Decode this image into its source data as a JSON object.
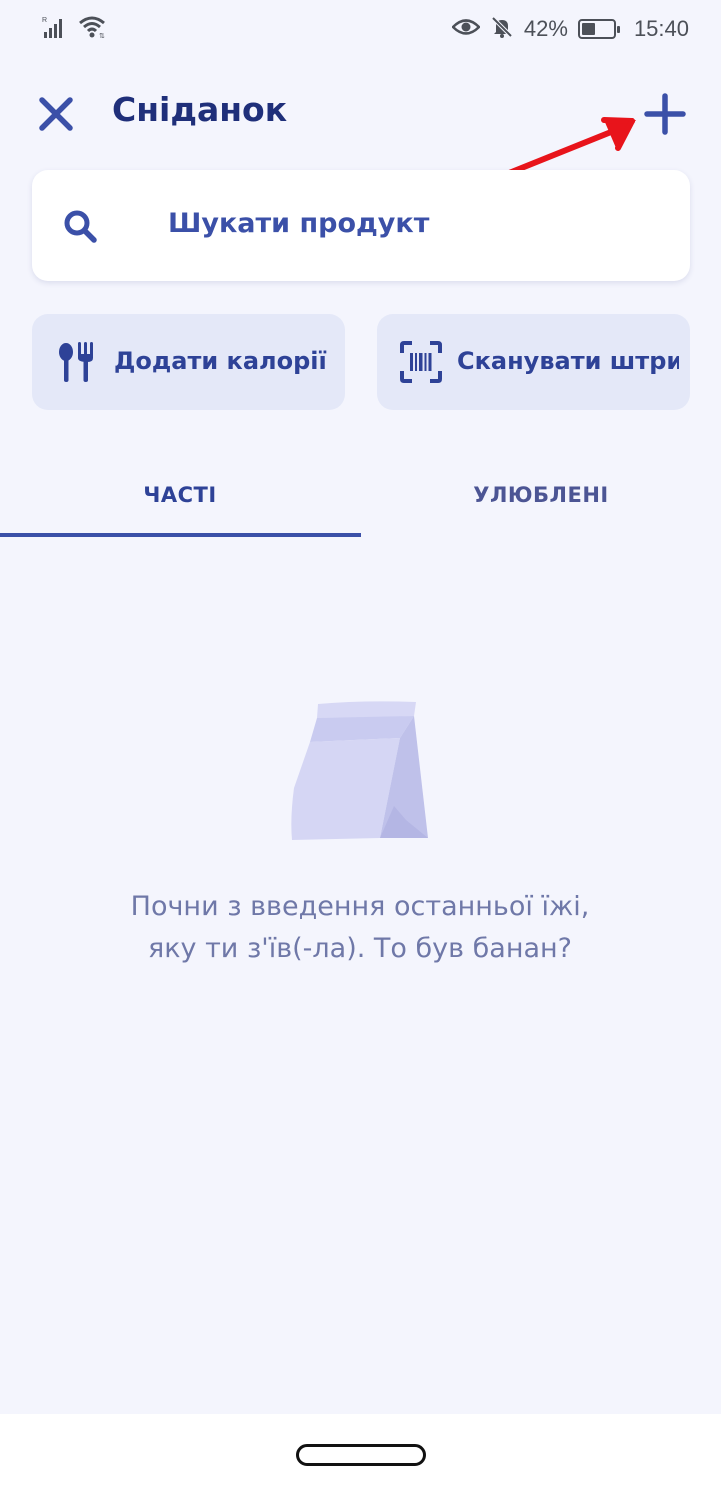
{
  "status_bar": {
    "battery_percent": "42%",
    "time": "15:40",
    "battery_level": 0.42,
    "icons": [
      "signal-icon",
      "wifi-icon",
      "eye-icon",
      "bell-off-icon",
      "battery-icon"
    ]
  },
  "header": {
    "title": "Сніданок",
    "close_icon": "close-icon",
    "add_icon": "plus-icon"
  },
  "search": {
    "label": "Шукати продукт",
    "icon": "search-icon"
  },
  "actions": [
    {
      "label": "Додати калорії",
      "icon": "cutlery-icon"
    },
    {
      "label": "Сканувати штри...",
      "icon": "barcode-icon"
    }
  ],
  "tabs": [
    {
      "label": "ЧАСТІ",
      "active": true
    },
    {
      "label": "УЛЮБЛЕНІ",
      "active": false
    }
  ],
  "empty_state": {
    "illustration": "paper-bag-icon",
    "line1": "Почни з введення останньої їжі,",
    "line2": "яку ти з'їв(-ла). То був банан?"
  },
  "colors": {
    "accent": "#3b50a8",
    "title": "#1f2f7a",
    "background": "#f4f5fd",
    "button_bg": "#e4e8f8",
    "annotation": "#e8141b"
  }
}
